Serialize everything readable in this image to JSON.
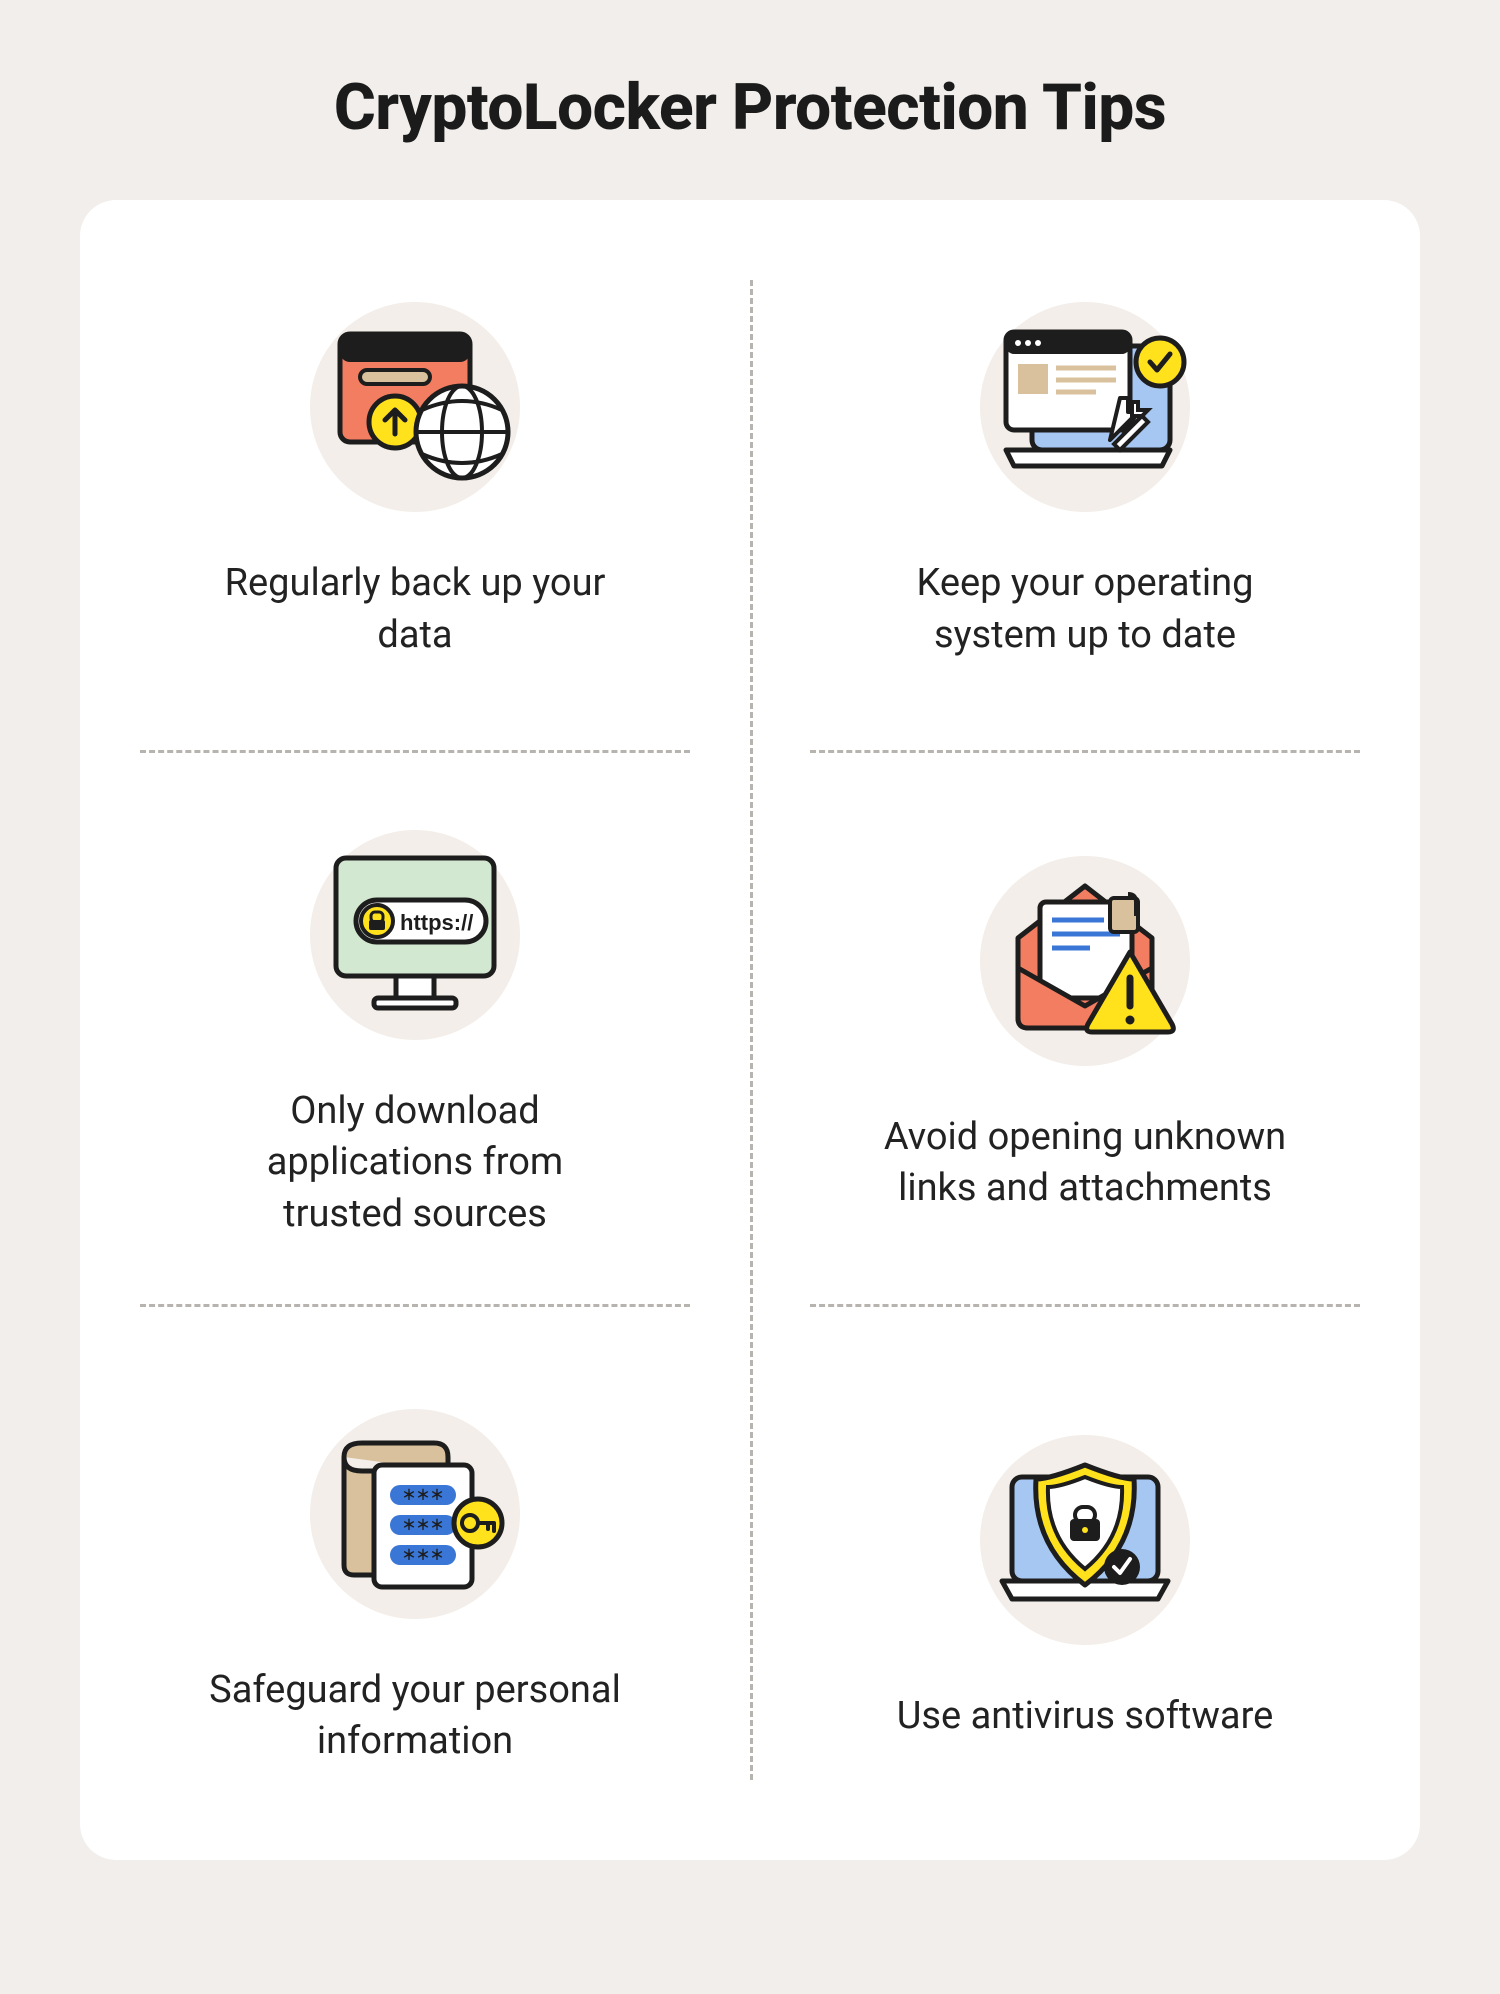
{
  "title": "CryptoLocker  Protection Tips",
  "tips": [
    {
      "icon": "backup-upload-icon",
      "caption": "Regularly back up your data"
    },
    {
      "icon": "system-update-icon",
      "caption": "Keep your operating system up to date"
    },
    {
      "icon": "trusted-source-icon",
      "caption": "Only download applications from trusted sources"
    },
    {
      "icon": "email-warning-icon",
      "caption": "Avoid opening unknown links and attachments"
    },
    {
      "icon": "safeguard-info-icon",
      "caption": "Safeguard your personal information"
    },
    {
      "icon": "antivirus-icon",
      "caption": "Use antivirus software"
    }
  ],
  "https_label": "https://",
  "colors": {
    "bg": "#f1eeeb",
    "card": "#ffffff",
    "divider": "#b7b3af",
    "accent_yellow": "#ffe11c",
    "accent_coral": "#f37d60",
    "accent_blue": "#a6c7f2",
    "accent_green": "#d3e8d0",
    "accent_tan": "#d8c19c",
    "icon_bg_circle": "#f3eee9",
    "stroke": "#1d1d1d"
  }
}
